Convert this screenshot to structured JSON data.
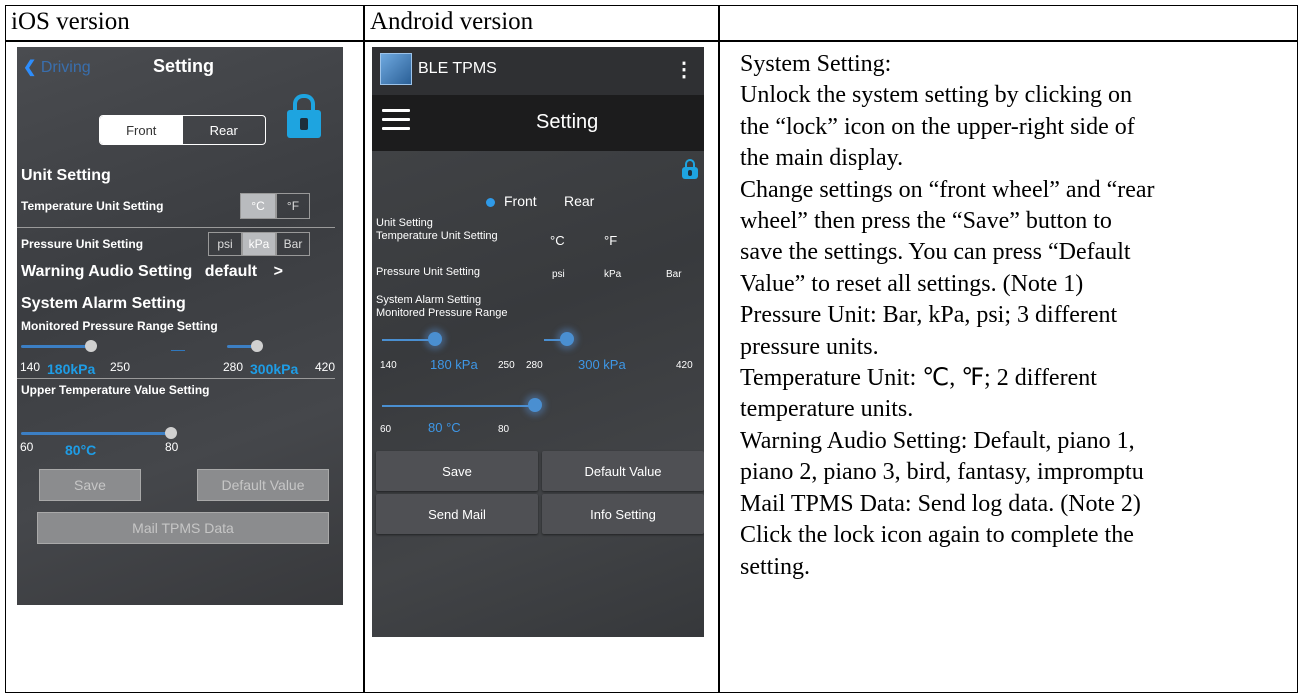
{
  "headers": {
    "col1": "iOS version",
    "col2": "Android version",
    "col3": ""
  },
  "ios": {
    "back_label": "Driving",
    "title": "Setting",
    "seg_front": "Front",
    "seg_rear": "Rear",
    "unit_setting": "Unit Setting",
    "temp_unit_label": "Temperature Unit Setting",
    "temp_c": "°C",
    "temp_f": "°F",
    "pressure_unit_label": "Pressure Unit Setting",
    "p_psi": "psi",
    "p_kpa": "kPa",
    "p_bar": "Bar",
    "warning_audio_label": "Warning Audio Setting",
    "warning_audio_value": "default",
    "chevron": ">",
    "system_alarm_label": "System Alarm Setting",
    "monitored_label": "Monitored Pressure Range Setting",
    "front_min": "140",
    "front_value": "180kPa",
    "front_max": "250",
    "range_dash": "—",
    "rear_min": "280",
    "rear_value": "300kPa",
    "rear_max": "420",
    "upper_temp_label": "Upper Temperature Value Setting",
    "temp_min": "60",
    "temp_value": "80°C",
    "temp_max": "80",
    "save": "Save",
    "default_value": "Default Value",
    "mail": "Mail TPMS Data"
  },
  "android": {
    "app_name": "BLE TPMS",
    "overflow": "⋮",
    "title": "Setting",
    "front": "Front",
    "rear": "Rear",
    "unit_setting": "Unit Setting",
    "temp_unit_label": "Temperature Unit Setting",
    "temp_c": "°C",
    "temp_f": "°F",
    "pressure_unit_label": "Pressure Unit Setting",
    "p_psi": "psi",
    "p_kpa": "kPa",
    "p_bar": "Bar",
    "system_alarm_label": "System Alarm Setting",
    "monitored_label": "Monitored Pressure Range",
    "front_min": "140",
    "front_value": "180 kPa",
    "front_max": "250",
    "rear_min": "280",
    "rear_value": "300 kPa",
    "rear_max": "420",
    "temp_min": "60",
    "temp_value": "80 °C",
    "temp_max": "80",
    "save": "Save",
    "default_value": "Default Value",
    "send_mail": "Send Mail",
    "info_setting": "Info Setting"
  },
  "description": [
    "System Setting:",
    "Unlock the system setting by clicking on",
    "the “lock” icon on the upper-right side of",
    "the main display.",
    "Change settings on “front wheel” and “rear",
    "wheel” then press the “Save” button to",
    "save the settings. You can press “Default",
    "Value” to reset all settings. (Note 1)",
    "Pressure Unit: Bar, kPa, psi;  3 different",
    "pressure units.",
    "Temperature Unit: ℃, ℉; 2 different",
    "temperature units.",
    "Warning Audio Setting: Default, piano 1,",
    "piano 2, piano 3, bird, fantasy, impromptu",
    "Mail TPMS Data: Send log data. (Note 2)",
    "Click the lock icon again to complete the",
    "setting."
  ],
  "colors": {
    "accent_blue": "#1e9de6",
    "lock_blue": "#1ea4e0",
    "phone_bg": "#3f4145"
  }
}
